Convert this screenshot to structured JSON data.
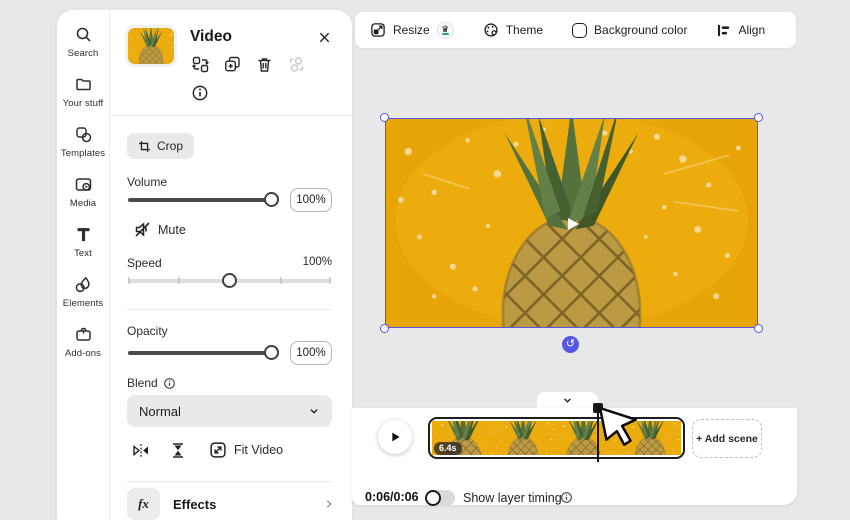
{
  "app": {
    "accent_color": "#5457e5",
    "canvas_bg": "#e8e8e9",
    "video_bg_yellow": "#e7a508"
  },
  "nav": {
    "items": [
      {
        "label": "Search",
        "icon": "search-icon"
      },
      {
        "label": "Your stuff",
        "icon": "folder-icon"
      },
      {
        "label": "Templates",
        "icon": "templates-icon"
      },
      {
        "label": "Media",
        "icon": "media-icon"
      },
      {
        "label": "Text",
        "icon": "text-icon"
      },
      {
        "label": "Elements",
        "icon": "elements-icon"
      },
      {
        "label": "Add-ons",
        "icon": "add-ons-icon"
      }
    ]
  },
  "inspector": {
    "title": "Video",
    "crop_label": "Crop",
    "volume_label": "Volume",
    "volume_value": "100%",
    "mute_label": "Mute",
    "speed_label": "Speed",
    "speed_value": "100%",
    "opacity_label": "Opacity",
    "opacity_value": "100%",
    "blend_label": "Blend",
    "blend_value": "Normal",
    "fit_video_label": "Fit Video",
    "fx_label": "fx",
    "effects_label": "Effects"
  },
  "toolbar": {
    "resize_label": "Resize",
    "theme_label": "Theme",
    "background_color_label": "Background color",
    "align_label": "Align"
  },
  "timeline": {
    "clip_duration": "6.4s",
    "add_scene_label": "+ Add scene",
    "time_display": "0:06/0:06",
    "show_layer_timing_label": "Show layer timing"
  }
}
